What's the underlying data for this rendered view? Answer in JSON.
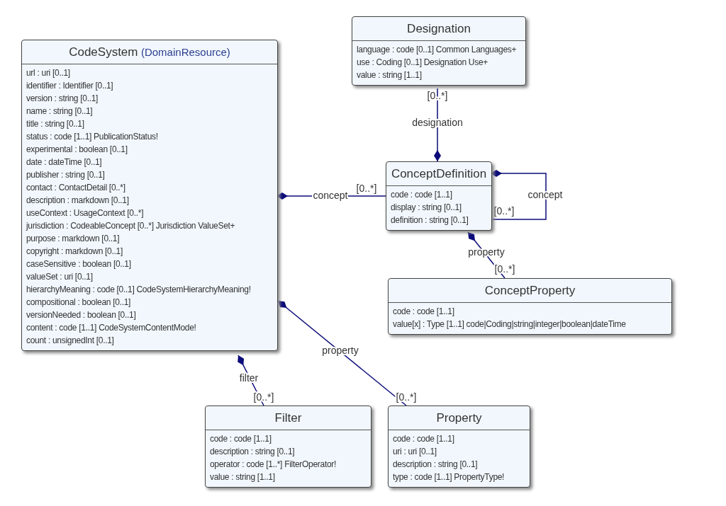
{
  "classes": [
    {
      "name": "CodeSystem",
      "parent": "(DomainResource)",
      "attributes": [
        "url : uri [0..1]",
        "identifier : Identifier [0..1]",
        "version : string [0..1]",
        "name : string [0..1]",
        "title : string [0..1]",
        "status : code [1..1] PublicationStatus!",
        "experimental : boolean [0..1]",
        "date : dateTime [0..1]",
        "publisher : string [0..1]",
        "contact : ContactDetail [0..*]",
        "description : markdown [0..1]",
        "useContext : UsageContext [0..*]",
        "jurisdiction : CodeableConcept [0..*] Jurisdiction ValueSet+",
        "purpose : markdown [0..1]",
        "copyright : markdown [0..1]",
        "caseSensitive : boolean [0..1]",
        "valueSet : uri [0..1]",
        "hierarchyMeaning : code [0..1] CodeSystemHierarchyMeaning!",
        "compositional : boolean [0..1]",
        "versionNeeded : boolean [0..1]",
        "content : code [1..1] CodeSystemContentMode!",
        "count : unsignedInt [0..1]"
      ]
    },
    {
      "name": "Designation",
      "attributes": [
        "language : code [0..1] Common Languages+",
        "use : Coding [0..1] Designation Use+",
        "value : string [1..1]"
      ]
    },
    {
      "name": "ConceptDefinition",
      "attributes": [
        "code : code [1..1]",
        "display : string [0..1]",
        "definition : string [0..1]"
      ]
    },
    {
      "name": "ConceptProperty",
      "attributes": [
        "code : code [1..1]",
        "value[x] : Type [1..1] code|Coding|string|integer|boolean|dateTime"
      ]
    },
    {
      "name": "Filter",
      "attributes": [
        "code : code [1..1]",
        "description : string [0..1]",
        "operator : code [1..*] FilterOperator!",
        "value : string [1..1]"
      ]
    },
    {
      "name": "Property",
      "attributes": [
        "code : code [1..1]",
        "uri : uri [0..1]",
        "description : string [0..1]",
        "type : code [1..1] PropertyType!"
      ]
    }
  ],
  "associations": [
    {
      "role": "designation",
      "multiplicity": "[0..*]"
    },
    {
      "role": "concept",
      "multiplicity": "[0..*]"
    },
    {
      "role": "concept",
      "multiplicity": "[0..*]"
    },
    {
      "role": "property",
      "multiplicity": "[0..*]"
    },
    {
      "role": "filter",
      "multiplicity": "[0..*]"
    },
    {
      "role": "property",
      "multiplicity": "[0..*]"
    }
  ]
}
